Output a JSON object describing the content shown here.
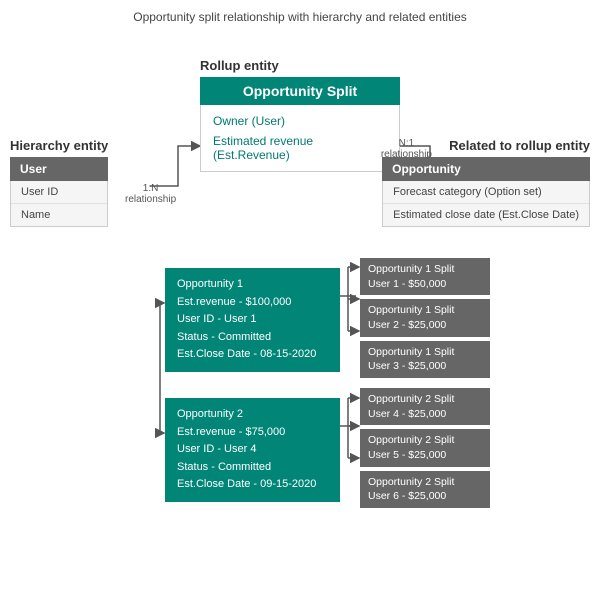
{
  "page": {
    "title": "Opportunity split relationship with hierarchy and related entities"
  },
  "rollup": {
    "label": "Rollup entity",
    "name": "Opportunity Split",
    "fields": [
      "Owner (User)",
      "Estimated revenue (Est.Revenue)"
    ]
  },
  "hierarchy": {
    "label": "Hierarchy entity",
    "name": "User",
    "fields": [
      "User ID",
      "Name"
    ]
  },
  "related": {
    "label": "Related to rollup entity",
    "name": "Opportunity",
    "fields": [
      "Forecast category (Option set)",
      "Estimated close date (Est.Close Date)"
    ]
  },
  "relationship_1n": {
    "line1": "1:N",
    "line2": "relationship"
  },
  "relationship_n1": {
    "line1": "N:1",
    "line2": "relationship"
  },
  "opportunities": [
    {
      "id": "opp1",
      "lines": [
        "Opportunity 1",
        "Est.revenue - $100,000",
        "User ID - User 1",
        "Status - Committed",
        "Est.Close Date - 08-15-2020"
      ],
      "splits": [
        [
          "Opportunity 1 Split",
          "User 1 - $50,000"
        ],
        [
          "Opportunity 1 Split",
          "User 2 - $25,000"
        ],
        [
          "Opportunity 1 Split",
          "User 3 - $25,000"
        ]
      ]
    },
    {
      "id": "opp2",
      "lines": [
        "Opportunity 2",
        "Est.revenue - $75,000",
        "User ID - User 4",
        "Status - Committed",
        "Est.Close Date - 09-15-2020"
      ],
      "splits": [
        [
          "Opportunity 2 Split",
          "User 4 - $25,000"
        ],
        [
          "Opportunity 2 Split",
          "User 5 - $25,000"
        ],
        [
          "Opportunity 2 Split",
          "User 6 - $25,000"
        ]
      ]
    }
  ]
}
